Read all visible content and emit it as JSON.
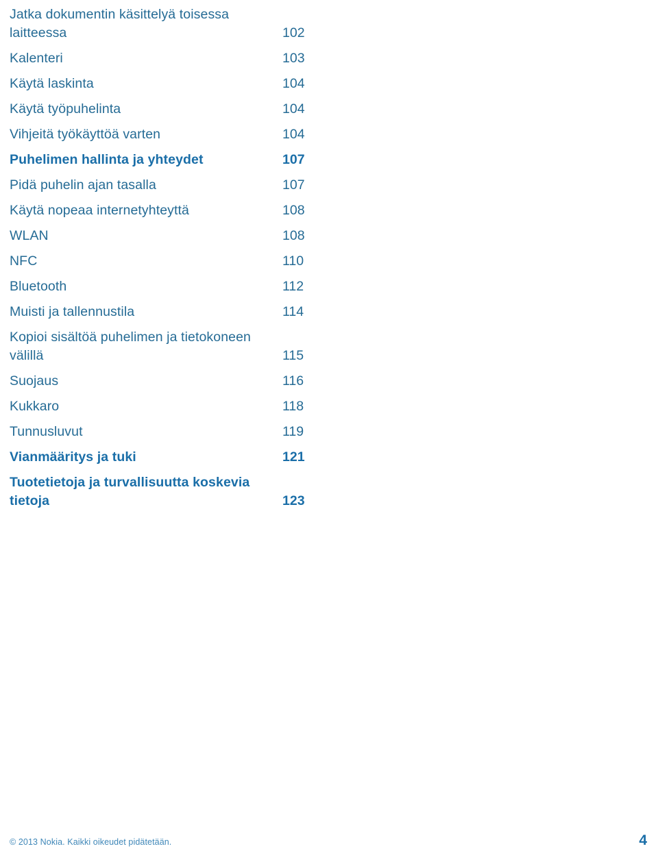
{
  "document": {
    "type": "table-of-contents",
    "language": "fi"
  },
  "colors": {
    "entry_blue": "#256b95",
    "heading_blue": "#1a6ea8",
    "footer_blue": "#3f87b8",
    "background": "#ffffff"
  },
  "toc": {
    "entries": [
      {
        "label": "Jatka dokumentin käsittelyä toisessa laitteessa",
        "page": "102",
        "bold": false
      },
      {
        "label": "Kalenteri",
        "page": "103",
        "bold": false
      },
      {
        "label": "Käytä laskinta",
        "page": "104",
        "bold": false
      },
      {
        "label": "Käytä työpuhelinta",
        "page": "104",
        "bold": false
      },
      {
        "label": "Vihjeitä työkäyttöä varten",
        "page": "104",
        "bold": false
      },
      {
        "label": "Puhelimen hallinta ja yhteydet",
        "page": "107",
        "bold": true
      },
      {
        "label": "Pidä puhelin ajan tasalla",
        "page": "107",
        "bold": false
      },
      {
        "label": "Käytä nopeaa internetyhteyttä",
        "page": "108",
        "bold": false
      },
      {
        "label": "WLAN",
        "page": "108",
        "bold": false
      },
      {
        "label": "NFC",
        "page": "110",
        "bold": false
      },
      {
        "label": "Bluetooth",
        "page": "112",
        "bold": false
      },
      {
        "label": "Muisti ja tallennustila",
        "page": "114",
        "bold": false
      },
      {
        "label": "Kopioi sisältöä puhelimen ja tietokoneen välillä",
        "page": "115",
        "bold": false
      },
      {
        "label": "Suojaus",
        "page": "116",
        "bold": false
      },
      {
        "label": "Kukkaro",
        "page": "118",
        "bold": false
      },
      {
        "label": "Tunnusluvut",
        "page": "119",
        "bold": false
      },
      {
        "label": "Vianmääritys ja tuki",
        "page": "121",
        "bold": true
      },
      {
        "label": "Tuotetietoja ja turvallisuutta koskevia tietoja",
        "page": "123",
        "bold": true
      }
    ]
  },
  "footer": {
    "copyright": "© 2013 Nokia. Kaikki oikeudet pidätetään.",
    "page_number": "4"
  }
}
